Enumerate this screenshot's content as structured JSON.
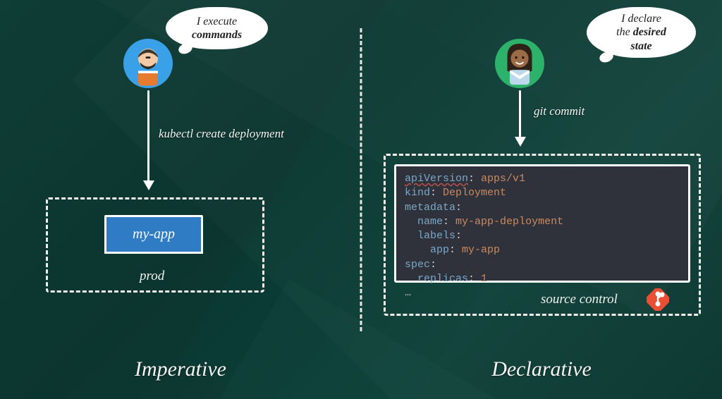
{
  "left": {
    "title": "Imperative",
    "bubble_line1": "I execute",
    "bubble_line2": "commands",
    "command": "kubectl create deployment",
    "app_name": "my-app",
    "env_label": "prod"
  },
  "right": {
    "title": "Declarative",
    "bubble_line1": "I declare",
    "bubble_line2": "the desired",
    "bubble_line3": "state",
    "command": "git commit",
    "box_label": "source control",
    "code": {
      "l1_key": "apiVersion",
      "l1_val": "apps/v1",
      "l2_key": "kind",
      "l2_val": "Deployment",
      "l3_key": "metadata",
      "l4_key": "name",
      "l4_val": "my-app-deployment",
      "l5_key": "labels",
      "l6_key": "app",
      "l6_val": "my-app",
      "l7_key": "spec",
      "l8_key": "replicas",
      "l8_val": "1",
      "ellipsis": "…"
    }
  },
  "icons": {
    "avatar_left": "male-avatar",
    "avatar_right": "female-avatar",
    "git": "git-icon"
  }
}
